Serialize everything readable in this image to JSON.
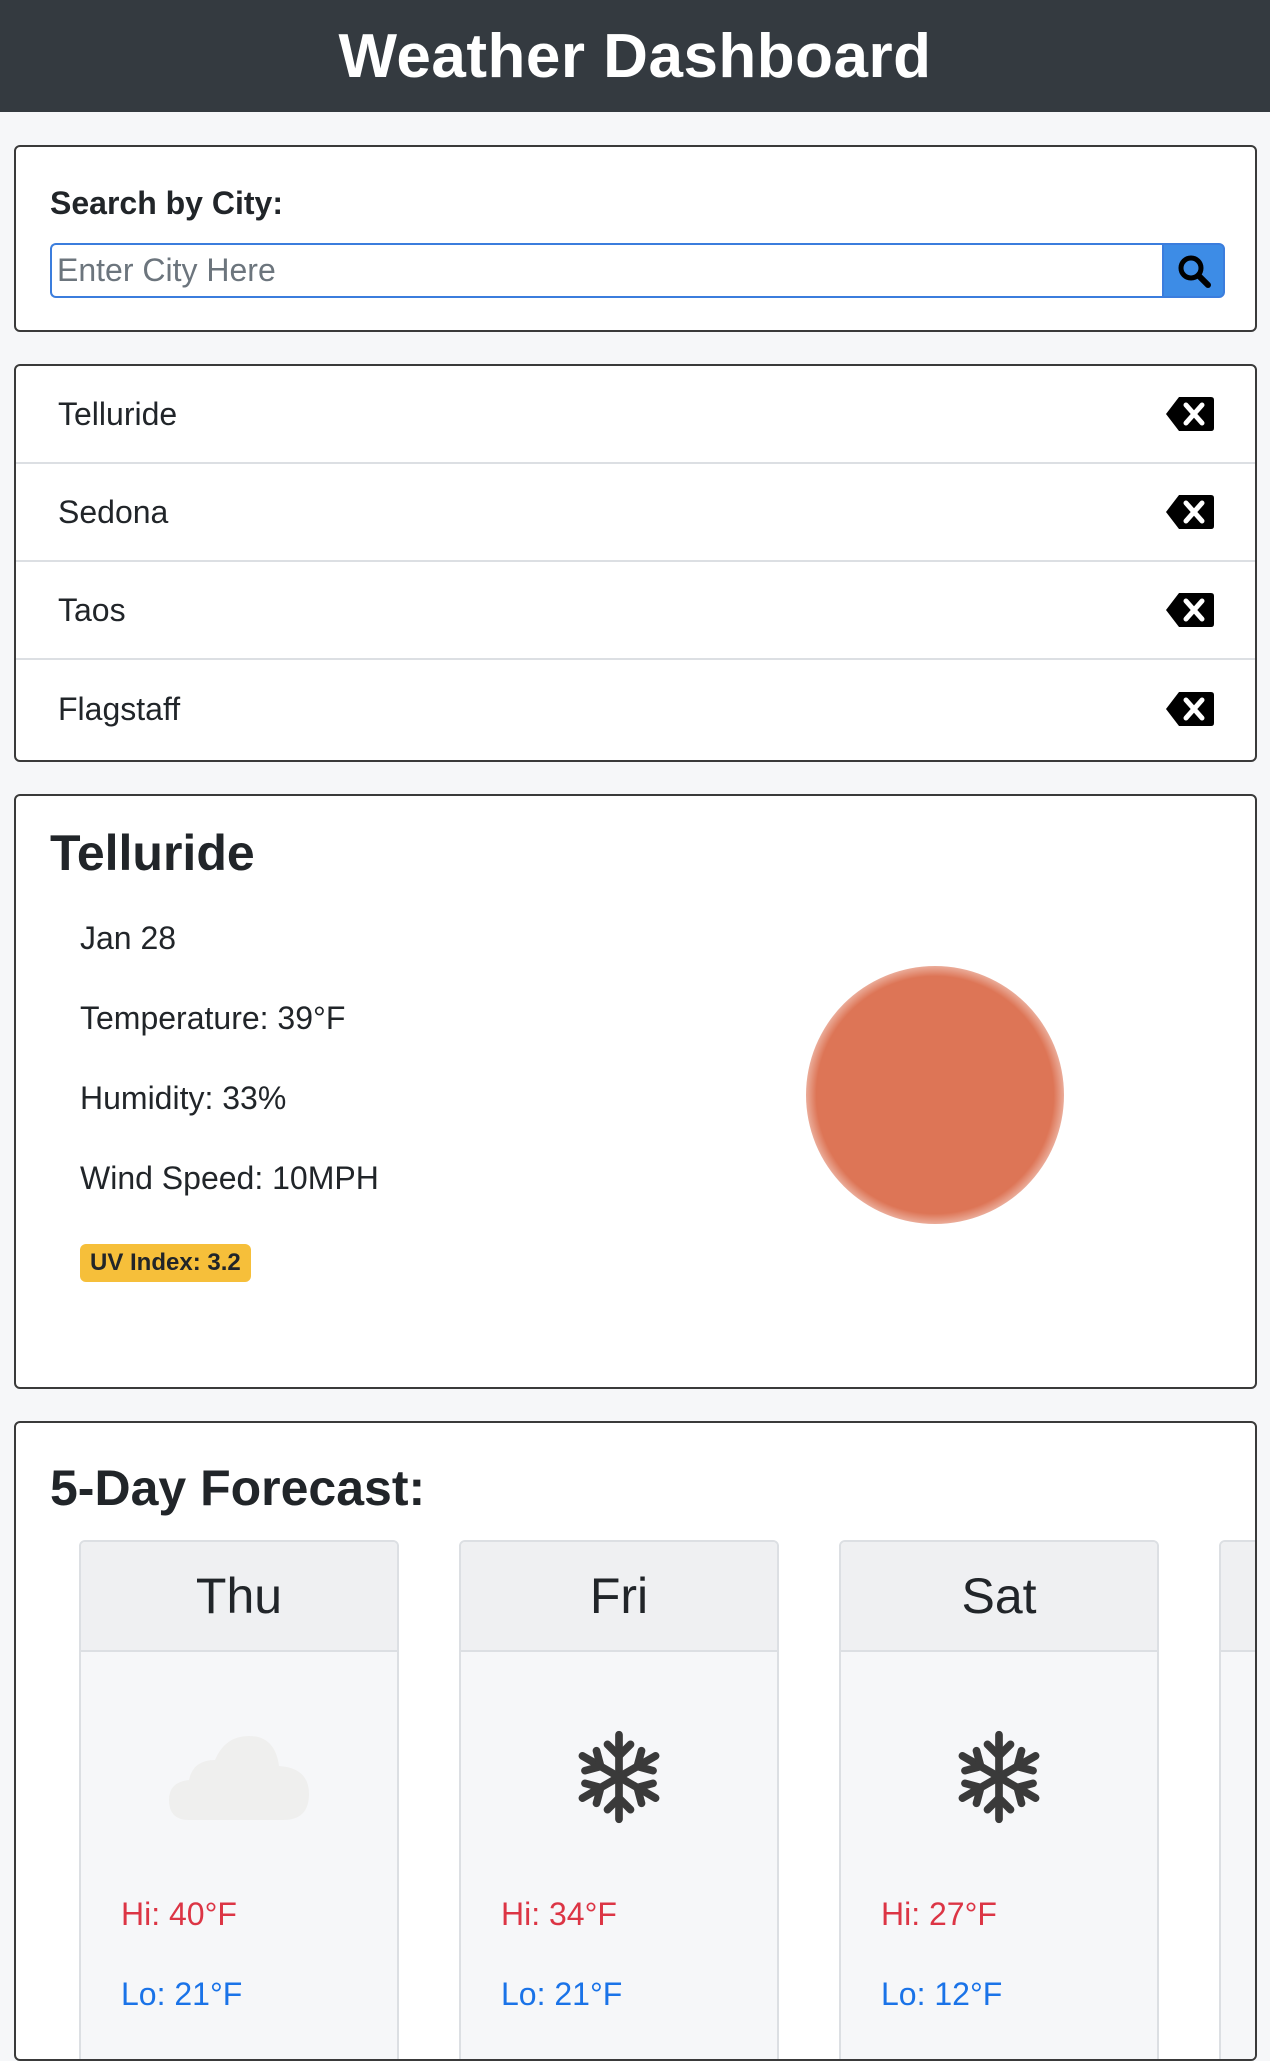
{
  "header": {
    "title": "Weather Dashboard"
  },
  "search": {
    "label": "Search by City:",
    "placeholder": "Enter City Here",
    "value": ""
  },
  "history": [
    {
      "city": "Telluride"
    },
    {
      "city": "Sedona"
    },
    {
      "city": "Taos"
    },
    {
      "city": "Flagstaff"
    }
  ],
  "current": {
    "city": "Telluride",
    "date": "Jan 28",
    "temperature": "Temperature: 39°F",
    "humidity": "Humidity: 33%",
    "wind": "Wind Speed: 10MPH",
    "uv": "UV Index: 3.2",
    "icon": "sun-icon",
    "uv_color": "#f6bf3a",
    "sun_color": "#dd7556"
  },
  "forecast": {
    "title": "5-Day Forecast:",
    "days": [
      {
        "day": "Thu",
        "icon": "cloud-icon",
        "hi": "Hi: 40°F",
        "lo": "Lo: 21°F"
      },
      {
        "day": "Fri",
        "icon": "snowflake-icon",
        "hi": "Hi: 34°F",
        "lo": "Lo: 21°F"
      },
      {
        "day": "Sat",
        "icon": "snowflake-icon",
        "hi": "Hi: 27°F",
        "lo": "Lo: 12°F"
      }
    ]
  },
  "colors": {
    "header_bg": "#343a40",
    "search_button": "#3d8ce6",
    "hi_text": "#dc3545",
    "lo_text": "#1a73e8"
  }
}
